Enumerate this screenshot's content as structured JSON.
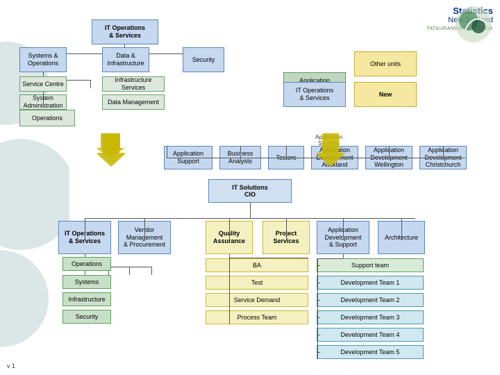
{
  "version": "v 1",
  "logo": {
    "name": "Statistics New Zealand",
    "sub": "TATAURANGA AOTEAROA"
  },
  "topSection": {
    "mainBox": {
      "label": "IT Operations\n& Services"
    },
    "leftBox": {
      "label": "Systems &\nOperations"
    },
    "midBox": {
      "label": "Data &\nInfrastructure"
    },
    "rightBox": {
      "label": "Security"
    },
    "serviceBox": {
      "label": "Service Centre"
    },
    "infraBox": {
      "label": "Infrastructure Services"
    },
    "sysAdminBox": {
      "label": "System Administration"
    },
    "dataMgmtBox": {
      "label": "Data Management"
    },
    "operationsBox": {
      "label": "Operations"
    }
  },
  "rightSection": {
    "appServicesBox": {
      "label": "Application\nServices"
    },
    "otherUnitsBox": {
      "label": "Other units"
    },
    "itOpsBox": {
      "label": "IT Operations\n& Services"
    },
    "newBox": {
      "label": "New"
    }
  },
  "middleSection": {
    "appServicesLabel": "Application\nServices",
    "appSupportBox": {
      "label": "Application\nSupport"
    },
    "bizAnalystsBox": {
      "label": "Business\nAnalysts"
    },
    "testersBox": {
      "label": "Testers"
    },
    "appDevAuckBox": {
      "label": "Application\nDevelopment\nAuckland"
    },
    "appDevWelBox": {
      "label": "Application\nDevelopment\nWellington"
    },
    "appDevChchBox": {
      "label": "Application\nDevelopment\nChristchurch"
    }
  },
  "bottomSection": {
    "cioBox": {
      "label": "IT Solutions\nCIO"
    },
    "itOpsServBox": {
      "label": "IT Operations\n& Services"
    },
    "vendorBox": {
      "label": "Vendor\nManagement\n& Procurement"
    },
    "qaBox": {
      "label": "Quality\nAssurance"
    },
    "projectBox": {
      "label": "Project\nServices"
    },
    "appDevSupportBox": {
      "label": "Application\nDevelopment\n& Support"
    },
    "architectureBox": {
      "label": "Architecture"
    },
    "operationsBox": {
      "label": "Operations"
    },
    "systemsBox": {
      "label": "Systems"
    },
    "infrastructureBox": {
      "label": "Infrastructure"
    },
    "securityBox": {
      "label": "Security"
    },
    "baBox": {
      "label": "BA"
    },
    "testBox": {
      "label": "Test"
    },
    "serviceDemandBox": {
      "label": "Service Demand"
    },
    "processTeamBox": {
      "label": "Process Team"
    },
    "supportTeamBox": {
      "label": "Support team"
    },
    "devTeam1Box": {
      "label": "Development Team 1"
    },
    "devTeam2Box": {
      "label": "Development Team 2"
    },
    "devTeam3Box": {
      "label": "Development Team 3"
    },
    "devTeam4Box": {
      "label": "Development Team 4"
    },
    "devTeam5Box": {
      "label": "Development Team 5"
    }
  }
}
